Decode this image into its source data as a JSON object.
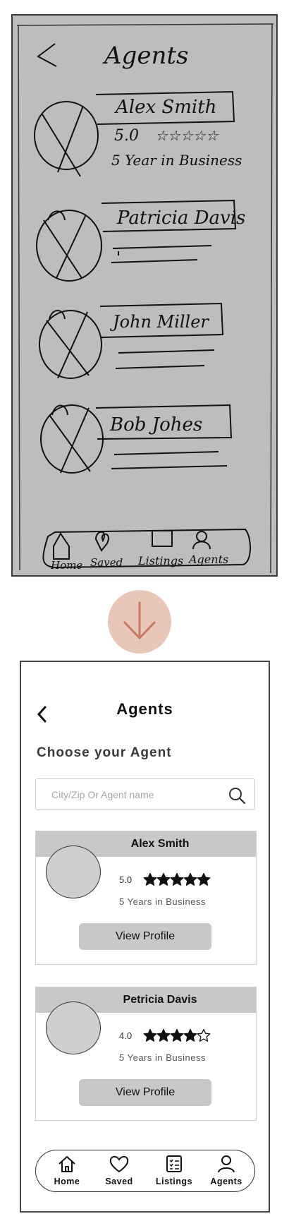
{
  "sketch": {
    "title": "Agents",
    "agents": [
      {
        "name": "Alex Smith",
        "rating_line": "5.0",
        "stars_text": "☆☆☆☆☆",
        "years_line": "5 Year in Business"
      },
      {
        "name": "Patricia Davis"
      },
      {
        "name": "John Miller"
      },
      {
        "name": "Bob Johes"
      }
    ],
    "nav": [
      "Home",
      "Saved",
      "Listings",
      "Agents"
    ]
  },
  "mockup": {
    "title": "Agents",
    "section_title": "Choose your Agent",
    "search": {
      "placeholder": "City/Zip Or Agent name",
      "value": ""
    },
    "agents": [
      {
        "name": "Alex Smith",
        "rating": 5.0,
        "rating_text": "5.0",
        "years": "5 Years in Business",
        "button": "View Profile"
      },
      {
        "name": "Petricia Davis",
        "rating": 4.0,
        "rating_text": "4.0",
        "years": "5 Years in Business",
        "button": "View Profile"
      }
    ],
    "nav": {
      "items": [
        {
          "label": "Home",
          "icon": "home-icon"
        },
        {
          "label": "Saved",
          "icon": "heart-icon"
        },
        {
          "label": "Listings",
          "icon": "listings-icon"
        },
        {
          "label": "Agents",
          "icon": "user-icon"
        }
      ]
    }
  },
  "colors": {
    "sketch_bg": "#bdbdbd",
    "arrow_circle": "#e9c7b8",
    "arrow": "#c47a63",
    "card_header": "#c8c8c8",
    "button": "#c8c8c8"
  }
}
